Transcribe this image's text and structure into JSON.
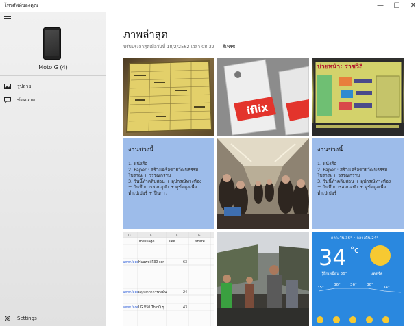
{
  "window": {
    "title": "โทรศัพท์ของคุณ",
    "controls": {
      "minimize": "—",
      "maximize": "☐",
      "close": "✕"
    }
  },
  "sidebar": {
    "device_name": "Moto G (4)",
    "items": [
      {
        "label": "รูปถ่าย",
        "icon": "photo-icon"
      },
      {
        "label": "ข้อความ",
        "icon": "message-icon"
      }
    ],
    "settings_label": "Settings"
  },
  "main": {
    "title": "ภาพล่าสุด",
    "updated": "ปรับปรุงล่าสุดเมื่อวันที่ 18/2/2562 เวลา 08:32",
    "refresh_label": "รีเฟรช",
    "notes": [
      {
        "title": "งานช่วงนี้",
        "lines": [
          "1. หนังสือ",
          "2. Paper : สร้างเครือข่ายวัฒนธรรม",
          "โบราณ + วรรณกรรม",
          "3. วันนี้ทำคลิปสอน + อุปกรณ์ทางห้อง",
          "+ บันทึกการสอนจุฬา + ดูข้อมูลเพื่อ",
          "ทำเปเปอร์ + ปีนกาว"
        ]
      },
      {
        "title": "งานช่วงนี้",
        "lines": [
          "1. หนังสือ",
          "2. Paper : สร้างเครือข่ายวัฒนธรรม",
          "โบราณ + วรรณกรรม",
          "3. วันนี้ทำคลิปสอน + อุปกรณ์ทางห้อง",
          "+ บันทึกการสอนจุฬา + ดูข้อมูลเพื่อ",
          "ทำเปเปอร์"
        ]
      }
    ],
    "photos": {
      "cards_brand": "iflix",
      "sign_text": "บ่ายหน้า: ราชวิถี",
      "sheet": {
        "cols": [
          "D",
          "E",
          "F",
          "G"
        ],
        "headers": [
          "message",
          "like",
          "share"
        ],
        "rows": [
          {
            "link": "www.face",
            "message": "Huawei P30 son",
            "like": "63"
          },
          {
            "link": "www.face",
            "message": "ผลุดทาคาการคอมัน",
            "like": "24"
          },
          {
            "link": "www.face",
            "message": "LG V50 ThinQ รุ",
            "like": "43"
          }
        ]
      },
      "weather": {
        "top": "กลางวัน 36° • กลางคืน 24°",
        "temp": "34",
        "unit": "°c",
        "feels": "รู้สึกเหมือน 36°",
        "cond": "แดดจัด",
        "hourly": [
          "35°",
          "36°",
          "36°",
          "36°",
          "34°"
        ]
      }
    }
  }
}
